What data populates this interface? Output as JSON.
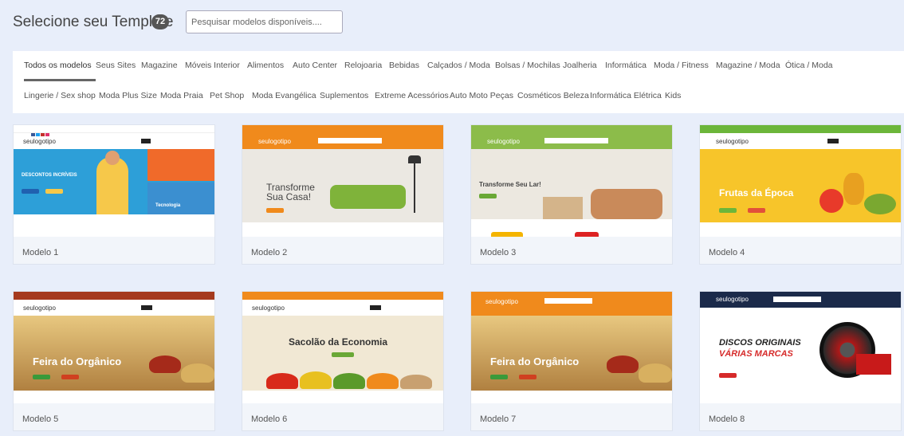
{
  "header": {
    "title": "Selecione seu Template",
    "count": "72",
    "search_placeholder": "Pesquisar modelos disponíveis...."
  },
  "tabs": {
    "row1": [
      "Todos os modelos",
      "Seus Sites",
      "Magazine",
      "Móveis Interior",
      "Alimentos",
      "Auto Center",
      "Relojoaria",
      "Bebidas",
      "Calçados / Moda",
      "Bolsas / Mochilas",
      "Joalheria",
      "Informática",
      "Moda / Fitness",
      "Magazine / Moda",
      "Ótica / Moda"
    ],
    "row2": [
      "Lingerie / Sex shop",
      "Moda Plus Size",
      "Moda Praia",
      "Pet Shop",
      "Moda Evangélica",
      "Suplementos",
      "Extreme Acessórios",
      "Auto Moto Peças",
      "Cosméticos Beleza",
      "Informática Elétrica",
      "Kids"
    ]
  },
  "templates": [
    {
      "label": "Modelo 1",
      "brand": "seulogotipo",
      "headline": "DESCONTOS INCRÍVEIS",
      "sub": "Tecnologia",
      "accent": "#2d9fd8"
    },
    {
      "label": "Modelo 2",
      "brand": "seulogotipo",
      "headline": "Transforme Sua Casa!",
      "accent": "#f08a1c"
    },
    {
      "label": "Modelo 3",
      "brand": "seulogotipo",
      "headline": "Transforme Seu Lar!",
      "accent": "#8cbc4a"
    },
    {
      "label": "Modelo 4",
      "brand": "seulogotipo",
      "headline": "Frutas da Época",
      "accent": "#6cb63a"
    },
    {
      "label": "Modelo 5",
      "brand": "seulogotipo",
      "headline": "Feira do Orgânico",
      "accent": "#c44a2a"
    },
    {
      "label": "Modelo 6",
      "brand": "seulogotipo",
      "headline": "Sacolão da Economia",
      "accent": "#f08a1c"
    },
    {
      "label": "Modelo 7",
      "brand": "seulogotipo",
      "headline": "Feira do Orgânico",
      "accent": "#f08a1c"
    },
    {
      "label": "Modelo 8",
      "brand": "seulogotipo",
      "headline": "DISCOS ORIGINAIS",
      "sub": "VÁRIAS MARCAS",
      "accent": "#1b2a4a"
    }
  ]
}
